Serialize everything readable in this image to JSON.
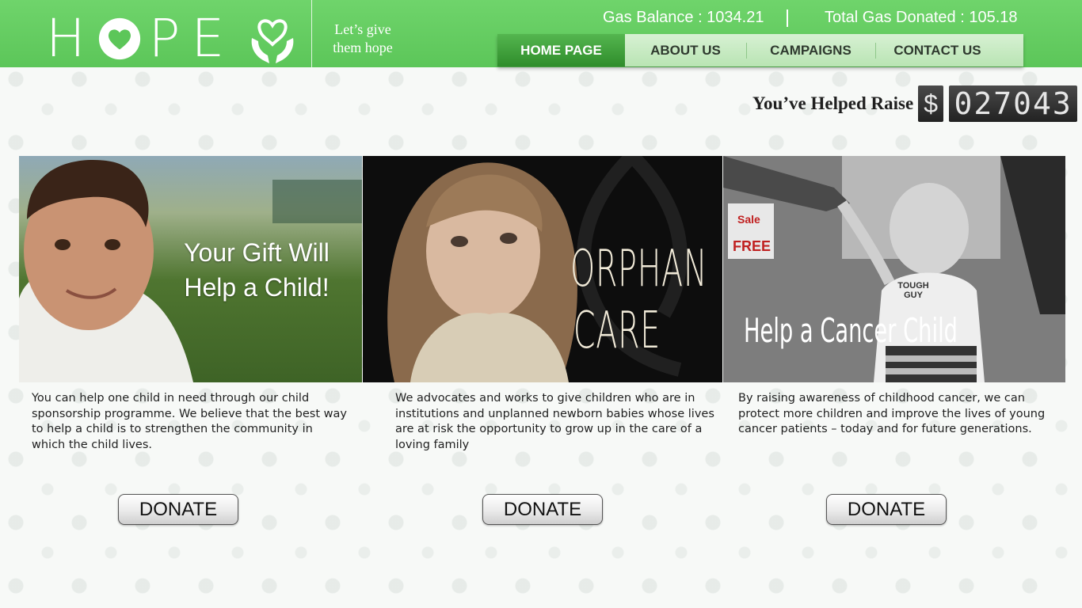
{
  "brand": {
    "logo_text_left": "H",
    "logo_text_right": "PE",
    "tagline_line1": "Let’s give",
    "tagline_line2": "them hope"
  },
  "gas": {
    "balance": "Gas Balance : 1034.21",
    "donated": "Total Gas Donated : 105.18"
  },
  "nav": [
    {
      "label": "HOME PAGE",
      "active": true
    },
    {
      "label": "ABOUT US",
      "active": false
    },
    {
      "label": "CAMPAIGNS",
      "active": false
    },
    {
      "label": "CONTACT US",
      "active": false
    }
  ],
  "raise": {
    "label": "You’ve Helped Raise",
    "currency": "$",
    "amount": "027043"
  },
  "cards": [
    {
      "image_caption": "Your Gift Will Help a Child!",
      "text": "You can help one child in need through our child sponsorship programme. We believe that the best way to help a child is to strengthen the community in which the child lives.",
      "button": "DONATE"
    },
    {
      "image_caption_line1": "ORPHAN",
      "image_caption_line2": "CARE",
      "text": "We advocates and works to give children who are in institutions and unplanned newborn babies whose lives are at risk the opportunity to grow up in the care of a loving family",
      "button": "DONATE"
    },
    {
      "image_caption": "Help a Cancer Child",
      "sign_text_1": "Sale",
      "sign_text_2": "FREE",
      "shirt_text": "TOUGH GUY",
      "text": "By raising awareness of childhood cancer, we can protect more children and improve the lives of young cancer patients – today and for future generations.",
      "button": "DONATE"
    }
  ],
  "colors": {
    "header_green": "#5cc659",
    "nav_active": "#3a9c35",
    "nav_bg": "#c7eac2"
  }
}
